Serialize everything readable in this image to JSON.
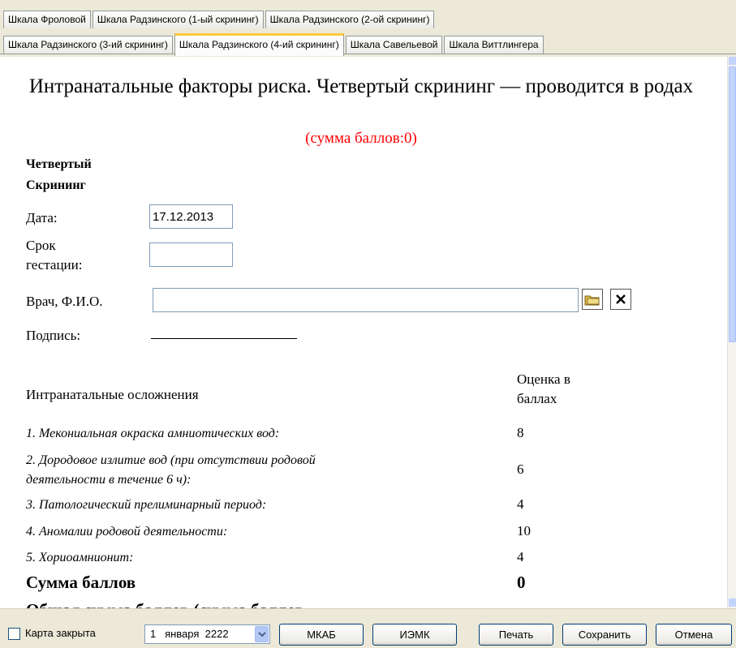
{
  "tabs": {
    "row1": [
      "Шкала Фроловой",
      "Шкала Радзинского (1-ый скрининг)",
      "Шкала Радзинского (2-ой скрининг)"
    ],
    "row2": [
      "Шкала Радзинского (3-ий скрининг)",
      "Шкала Радзинского (4-ий скрининг)",
      "Шкала Савельевой",
      "Шкала Виттлингера"
    ],
    "active": "Шкала Радзинского (4-ий скрининг)"
  },
  "form": {
    "title": "Интранатальные факторы риска. Четвертый скрининг — проводится в родах",
    "sum_subtitle": "(сумма баллов:0)",
    "section_heading_line1": "Четвертый",
    "section_heading_line2": "Скрининг",
    "date_label": "Дата:",
    "date_value": "17.12.2013",
    "term_label_line1": "Срок",
    "term_label_line2": "гестации:",
    "term_value": "",
    "doctor_label": "Врач, Ф.И.О.",
    "doctor_value": "",
    "signature_label": "Подпись:"
  },
  "table": {
    "header_left": "Интранатальные осложнения",
    "header_right_line1": "Оценка в",
    "header_right_line2": "баллах",
    "rows": [
      {
        "text": "1. Мекониальная окраска амниотических вод:",
        "score": "8"
      },
      {
        "text": "2. Дородовое излитие вод (при отсутствии родовой",
        "text2": "деятельности в течение 6 ч):",
        "score": "6"
      },
      {
        "text": "3. Патологический прелиминарный период:",
        "score": "4"
      },
      {
        "text": "4. Аномалии родовой деятельности:",
        "score": "10"
      },
      {
        "text": "5. Хориоамнионит:",
        "score": "4"
      }
    ],
    "sum_label": "Сумма баллов",
    "sum_value": "0",
    "cut_off_text": "Общая сумма баллов (сумма баллов"
  },
  "bottom_bar": {
    "checkbox_label": "Карта закрыта",
    "date_day": "1",
    "date_month": "января",
    "date_year": "2222",
    "buttons": [
      "МКАБ",
      "ИЭМК",
      "Печать",
      "Сохранить",
      "Отмена"
    ]
  }
}
